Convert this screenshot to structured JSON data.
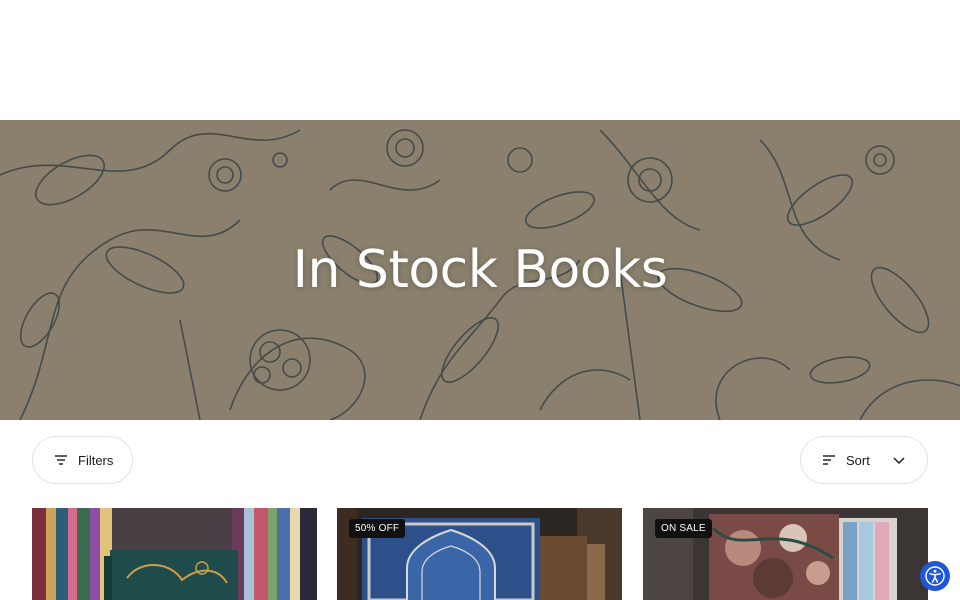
{
  "hero": {
    "title": "In Stock Books"
  },
  "toolbar": {
    "filters_label": "Filters",
    "filters_icon": "filter-lines-icon",
    "sort_label": "Sort",
    "sort_icon": "sort-lines-icon",
    "sort_chevron_icon": "chevron-down-icon"
  },
  "products": [
    {
      "badge": "",
      "image": "green-gilded-book-on-shelf"
    },
    {
      "badge": "50% OFF",
      "image": "blue-ornate-book-cover"
    },
    {
      "badge": "ON SALE",
      "image": "floral-slipcase-book-set"
    }
  ],
  "accessibility": {
    "icon": "accessibility-icon"
  },
  "colors": {
    "hero_background": "#8a806d",
    "hero_ink": "#2e3a40",
    "badge_background": "#111111",
    "accessibility_button": "#1f57d6"
  }
}
